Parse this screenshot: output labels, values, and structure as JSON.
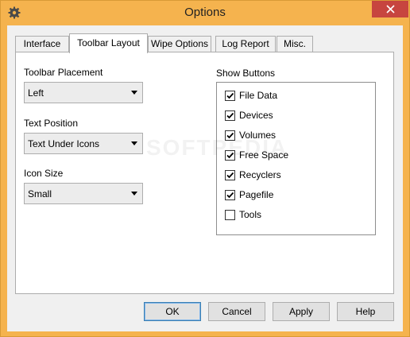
{
  "window": {
    "title": "Options"
  },
  "tabs": [
    {
      "label": "Interface",
      "active": false
    },
    {
      "label": "Toolbar Layout",
      "active": true
    },
    {
      "label": "Wipe Options",
      "active": false
    },
    {
      "label": "Log Report",
      "active": false
    },
    {
      "label": "Misc.",
      "active": false
    }
  ],
  "toolbar_placement": {
    "label": "Toolbar Placement",
    "value": "Left"
  },
  "text_position": {
    "label": "Text Position",
    "value": "Text Under Icons"
  },
  "icon_size": {
    "label": "Icon Size",
    "value": "Small"
  },
  "show_buttons": {
    "label": "Show Buttons",
    "items": [
      {
        "label": "File Data",
        "checked": true
      },
      {
        "label": "Devices",
        "checked": true
      },
      {
        "label": "Volumes",
        "checked": true
      },
      {
        "label": "Free Space",
        "checked": true
      },
      {
        "label": "Recyclers",
        "checked": true
      },
      {
        "label": "Pagefile",
        "checked": true
      },
      {
        "label": "Tools",
        "checked": false
      }
    ]
  },
  "buttons": {
    "ok": "OK",
    "cancel": "Cancel",
    "apply": "Apply",
    "help": "Help"
  },
  "watermark": "SOFTPEDIA",
  "colors": {
    "frame": "#f5b34e",
    "close": "#c7453f",
    "panel": "#f0f0f0"
  },
  "icons": {
    "app": "gear-icon",
    "close": "close-icon",
    "check": "check-icon",
    "dropdown": "chevron-down-icon"
  }
}
